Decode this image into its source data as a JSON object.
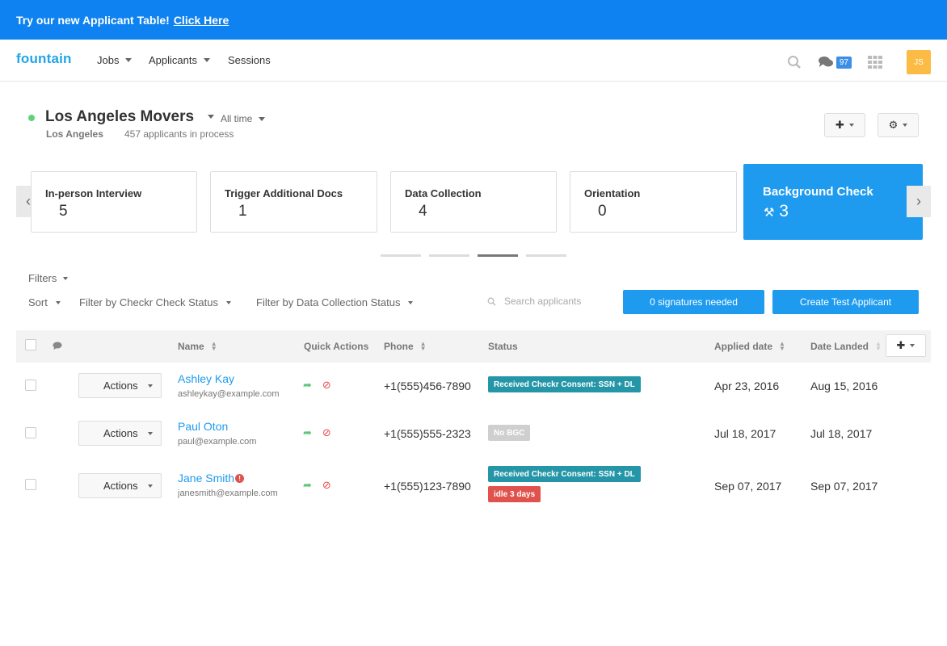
{
  "banner": {
    "text": "Try our new Applicant Table!",
    "link": "Click Here"
  },
  "nav": {
    "logo": "fountain",
    "items": [
      "Jobs",
      "Applicants",
      "Sessions"
    ],
    "messages_count": "97",
    "avatar_initials": "JS"
  },
  "job": {
    "title": "Los Angeles Movers",
    "time_filter": "All time",
    "location": "Los Angeles",
    "applicants": "457 applicants in process"
  },
  "stages": [
    {
      "name": "In-person Interview",
      "count": "5"
    },
    {
      "name": "Trigger Additional Docs",
      "count": "1"
    },
    {
      "name": "Data Collection",
      "count": "4"
    },
    {
      "name": "Orientation",
      "count": "0"
    },
    {
      "name": "Background Check",
      "count": "3"
    }
  ],
  "filters": {
    "filters_label": "Filters",
    "sort_label": "Sort",
    "checkr": "Filter by Checkr Check Status",
    "data_collection": "Filter by Data Collection Status",
    "search_placeholder": "Search applicants",
    "signatures_btn": "0 signatures needed",
    "create_btn": "Create Test Applicant"
  },
  "table": {
    "headers": {
      "name": "Name",
      "quick_actions": "Quick Actions",
      "phone": "Phone",
      "status": "Status",
      "applied": "Applied date",
      "landed": "Date Landed"
    },
    "actions_label": "Actions",
    "rows": [
      {
        "name": "Ashley Kay",
        "email": "ashleykay@example.com",
        "phone": "+1(555)456-7890",
        "status": "Received Checkr Consent: SSN + DL",
        "applied": "Apr 23, 2016",
        "landed": "Aug 15, 2016"
      },
      {
        "name": "Paul Oton",
        "email": "paul@example.com",
        "phone": "+1(555)555-2323",
        "status": "No BGC",
        "applied": "Jul 18, 2017",
        "landed": "Jul 18, 2017"
      },
      {
        "name": "Jane Smith",
        "email": "janesmith@example.com",
        "phone": "+1(555)123-7890",
        "status": "Received Checkr Consent: SSN + DL",
        "status2": "idle 3 days",
        "applied": "Sep 07, 2017",
        "landed": "Sep 07, 2017"
      }
    ]
  },
  "colors": {
    "primary": "#1e9bef",
    "banner": "#0d82f0",
    "teal_tag": "#2596a7",
    "red_tag": "#e0524d",
    "avatar": "#fbbb45"
  }
}
